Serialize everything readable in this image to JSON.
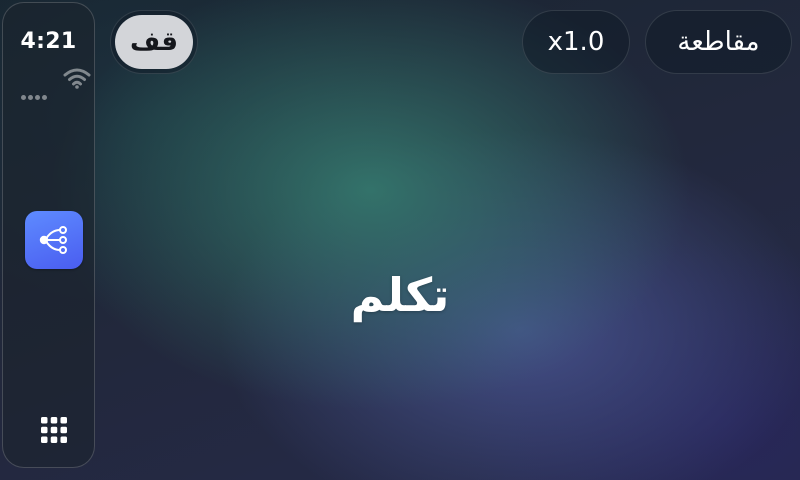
{
  "status_bar": {
    "time": "4:21",
    "signal_icon": "cellular-signal-icon",
    "wifi_icon": "wifi-icon"
  },
  "sidebar": {
    "app_icon": "share-nodes-icon",
    "app_launcher_icon": "app-grid-icon"
  },
  "toolbar": {
    "stop_label": "قف",
    "speed_label": "x1.0",
    "interrupt_label": "مقاطعة"
  },
  "main": {
    "prompt": "تكلم"
  },
  "colors": {
    "app_tile": "#5471f7",
    "stop_button_bg": "#d3d5d9"
  }
}
